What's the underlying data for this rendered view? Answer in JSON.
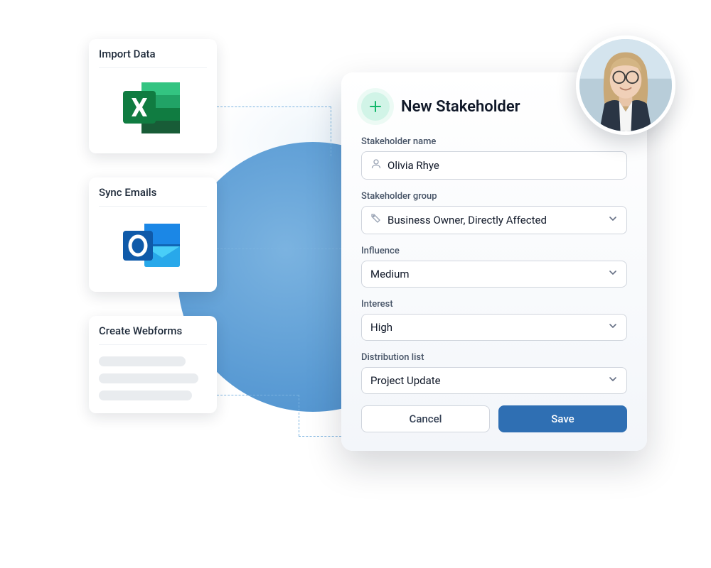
{
  "cards": {
    "import": {
      "title": "Import Data",
      "icon": "excel-icon"
    },
    "sync": {
      "title": "Sync Emails",
      "icon": "outlook-icon"
    },
    "webforms": {
      "title": "Create Webforms"
    }
  },
  "form": {
    "title": "New Stakeholder",
    "fields": {
      "name": {
        "label": "Stakeholder name",
        "value": "Olivia Rhye"
      },
      "group": {
        "label": "Stakeholder group",
        "value": "Business Owner, Directly Affected"
      },
      "influence": {
        "label": "Influence",
        "value": "Medium"
      },
      "interest": {
        "label": "Interest",
        "value": "High"
      },
      "distribution": {
        "label": "Distribution list",
        "value": "Project Update"
      }
    },
    "buttons": {
      "cancel": "Cancel",
      "save": "Save"
    }
  },
  "colors": {
    "accent": "#2f6fb3",
    "plus_bg": "#d1f4e7",
    "plus_fg": "#12b76a"
  }
}
